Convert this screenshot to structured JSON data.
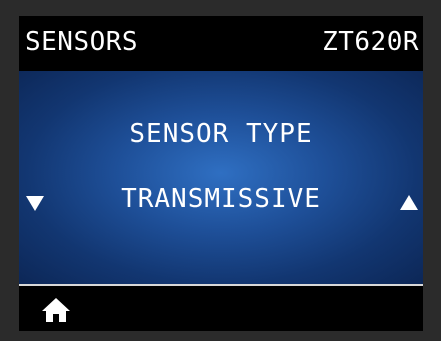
{
  "header": {
    "title": "SENSORS",
    "model": "ZT620R"
  },
  "setting": {
    "name": "SENSOR TYPE",
    "value": "TRANSMISSIVE"
  },
  "navigation": {
    "prev_icon": "triangle-down-icon",
    "next_icon": "triangle-up-icon",
    "home_icon": "home-icon"
  },
  "colors": {
    "background_accent": "#1e4f98",
    "text": "#ffffff",
    "bar": "#000000"
  }
}
